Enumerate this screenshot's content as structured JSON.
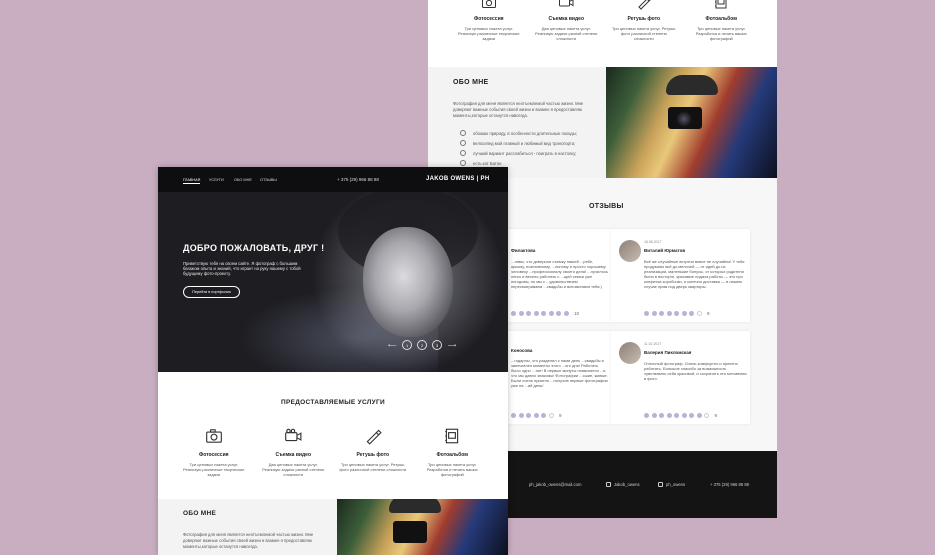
{
  "services": {
    "title": "ПРЕДОСТАВЛЯЕМЫЕ УСЛУГИ",
    "items": [
      {
        "title": "Фотосессия",
        "desc": "Три ценовых пакета услуг. Реализую различные творческие задачи",
        "icon": "camera-icon"
      },
      {
        "title": "Съемка видео",
        "desc": "Два ценовых пакета услуг. Реализую задачи разной степени сложности",
        "icon": "video-camera-icon"
      },
      {
        "title": "Ретушь фото",
        "desc": "Три ценовых пакета услуг. Ретушь фото различной степени сложности",
        "icon": "retouch-brush-icon"
      },
      {
        "title": "Фотоальбом",
        "desc": "Три ценовых пакета услуг. Разработка и печать ваших фотографий",
        "icon": "photo-album-icon"
      }
    ]
  },
  "about": {
    "title": "ОБО МНЕ",
    "text": "Фотография для меня является неотъемлемой частью жизни. Мне доверяют важные события своей жизни и взамен я предоставляю моменты,которые останутся навсегда.",
    "text_short": "Фотография для меня является неотъемлемой частью жизни. Мне доверяют важные события своей жизни и взамен я предоставляю моменты,которые останутся навсегда.",
    "list": [
      "обожаю природу, в особенности длительные походы;",
      "велосипед мой главный и любимый вид транспорта;",
      "лучший вариант расслабиться - поиграть в настолку;",
      "есть кот Батон"
    ]
  },
  "reviews": {
    "title": "ОТЗЫВЫ",
    "items": [
      {
        "date": "",
        "name": "Филактова",
        "text": "...ливы, что доверили съемку нашей ...ребе, яркому, позитивному, ...льному и просто хорошему человеку ...профессионалу своего дела! ...лучилось легко и весело работать с ...щей семьи уже погодовы, но мы с ...удовольствием пересматриваем ...свадьбы и вспоминаем тебя:)",
        "score": "10",
        "filled": 8
      },
      {
        "date": "16.08.2017",
        "name": "Виталий Юрматов",
        "text": "Всё же случайные встречи вовсе не случайны! У тебя продумано всё до мелочей — от идей до их реализации, маленькие бонусы, от которых родители были в восторге, красивые подача работы — это про конфетка коробочки, и конечно доставка — в нашем случае прям под дверь квартиры.",
        "score": "9",
        "filled": 7
      },
      {
        "date": "",
        "name": "Коносова",
        "text": "...годарны, что разделил с нами день ...свадьбы и запечатлел моменты этого ...ого дня! Работать было одно ...тие! В первые минуты появляется ...е, что мы давно знакомы! Фотографии ...сшие, живые. Были очень приятно ...получив первые фотографии уже на ...ий день!",
        "score": "9",
        "filled": 7
      },
      {
        "date": "11.02.2017",
        "name": "Валерия Пикломская",
        "text": "Отличный фотограф. Очень комфортно и приятно работать. Большое спасибо за возможность чувствовать себя красивой, и сохранить эти мгновения в фото.",
        "score": "9",
        "filled": 8
      }
    ]
  },
  "footer": {
    "items": [
      {
        "text": "ph_jakob_owens@mail.com",
        "icon": "mail-icon"
      },
      {
        "text": "Jakob_owens",
        "icon": "instagram-icon"
      },
      {
        "text": "ph_owens",
        "icon": "vk-icon"
      },
      {
        "text": "+ 375 (29) 966 88 88",
        "icon": ""
      }
    ]
  },
  "nav": {
    "links": [
      "ГЛАВНАЯ",
      "УСЛУГИ",
      "ОБО МНЕ",
      "ОТЗЫВЫ"
    ],
    "phone": "+ 375 (29) 966 88 88",
    "brand": "JAKOB OWENS | PH"
  },
  "hero": {
    "title": "ДОБРО ПОЖАЛОВАТЬ, ДРУГ !",
    "subtitle": "Приветствую тебя на своем сайте. Я фотограф с большим багажом опыта и знаний, что играет на руку нашему с тобой будущему фото-проекту.",
    "button": "Перейти в портфолио",
    "pages": [
      "1",
      "2",
      "3"
    ],
    "prev_arrow": "⟵",
    "next_arrow": "⟶"
  }
}
